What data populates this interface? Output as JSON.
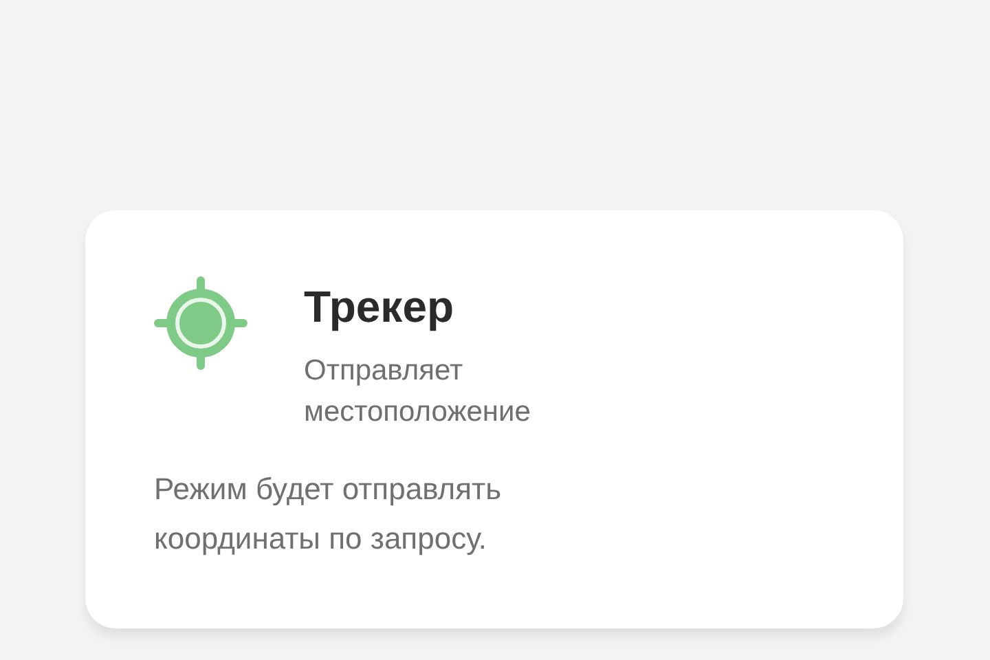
{
  "card": {
    "title": "Трекер",
    "subtitle": "Отправляет местоположение",
    "description": "Режим будет отправлять координаты по запросу."
  }
}
